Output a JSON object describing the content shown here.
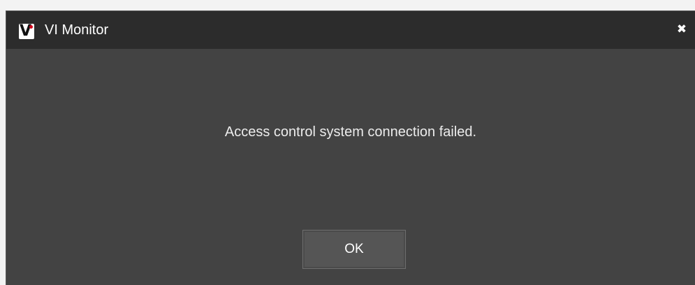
{
  "window": {
    "title": "VI Monitor",
    "app_icon": "vi-logo-icon",
    "close_icon": "close-icon",
    "close_glyph": "✖"
  },
  "dialog": {
    "message": "Access control system connection failed.",
    "ok_label": "OK"
  },
  "colors": {
    "titlebar_bg": "#2c2c2c",
    "body_bg": "#434343",
    "button_bg": "#555555",
    "logo_dot": "#d0021b",
    "text": "#ffffff"
  }
}
